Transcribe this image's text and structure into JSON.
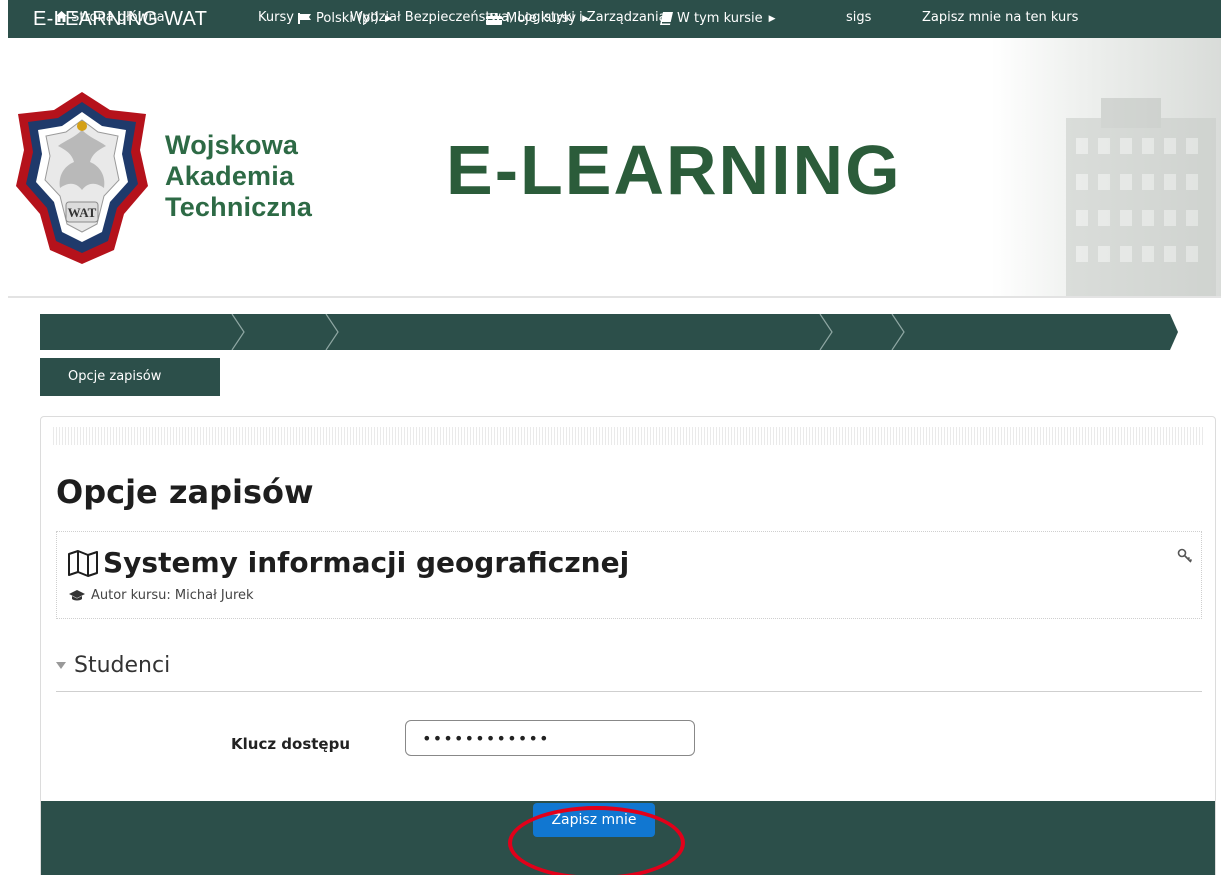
{
  "navbar": {
    "brand": "E-LEARNING WAT",
    "items": [
      {
        "label": "Polski (pl)",
        "icon": "flag-icon"
      },
      {
        "label": "Moje kursy",
        "icon": "briefcase-icon"
      },
      {
        "label": "W tym kursie",
        "icon": "book-icon"
      }
    ]
  },
  "header": {
    "logo_lines": [
      "Wojskowa",
      "Akademia",
      "Techniczna"
    ],
    "logo_badge": "WAT",
    "title": "E-LEARNING"
  },
  "breadcrumb": {
    "items": [
      {
        "label": "Strona główna",
        "icon": "home-icon"
      },
      {
        "label": "Kursy"
      },
      {
        "label": "Wydział Bezpieczeństwa, Logistyki i Zarządzania"
      },
      {
        "label": "sigs"
      },
      {
        "label": "Zapisz mnie na ten kurs"
      }
    ],
    "current": "Opcje zapisów"
  },
  "main": {
    "page_title": "Opcje zapisów",
    "course": {
      "name": "Systemy informacji geograficznej",
      "author": "Autor kursu: Michał Jurek"
    },
    "section": {
      "title": "Studenci"
    },
    "form": {
      "key_label": "Klucz dostępu",
      "key_value": "••••••••••••",
      "submit_label": "Zapisz mnie"
    }
  },
  "colors": {
    "nav_bg": "#2c4f4a",
    "brand_green": "#2b5c3a",
    "button_blue": "#1177d1",
    "highlight_red": "#e2001a"
  }
}
